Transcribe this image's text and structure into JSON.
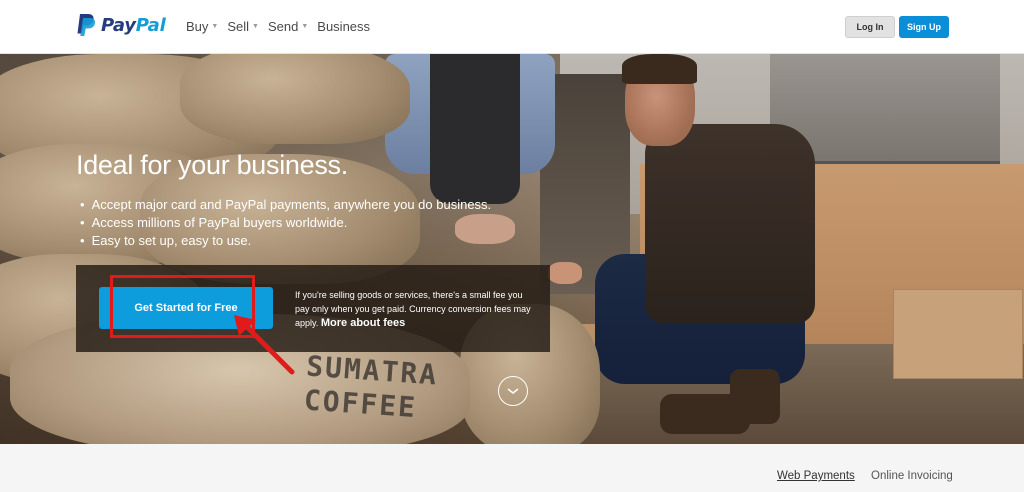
{
  "header": {
    "logo_text_pay": "Pay",
    "logo_text_pal": "Pal",
    "nav": [
      {
        "label": "Buy",
        "has_dropdown": true
      },
      {
        "label": "Sell",
        "has_dropdown": true
      },
      {
        "label": "Send",
        "has_dropdown": true
      },
      {
        "label": "Business",
        "has_dropdown": false
      }
    ],
    "login_label": "Log In",
    "signup_label": "Sign Up"
  },
  "hero": {
    "title": "Ideal for your business.",
    "bullets": [
      "Accept major card and PayPal payments, anywhere you do business.",
      "Access millions of PayPal buyers worldwide.",
      "Easy to set up, easy to use."
    ],
    "cta_label": "Get Started for Free",
    "cta_description": "If you're selling goods or services, there's a small fee you pay only when you get paid. Currency conversion fees may apply.",
    "fees_link": "More about fees",
    "sack_text_line1": "SUMATRA",
    "sack_text_line2": "COFFEE"
  },
  "subnav": {
    "links": [
      "Web Payments",
      "Online Invoicing"
    ]
  },
  "colors": {
    "brand_dark": "#253b80",
    "brand_light": "#179bd7",
    "cta_blue": "#0d9cdc",
    "highlight_red": "#e11b1b"
  }
}
